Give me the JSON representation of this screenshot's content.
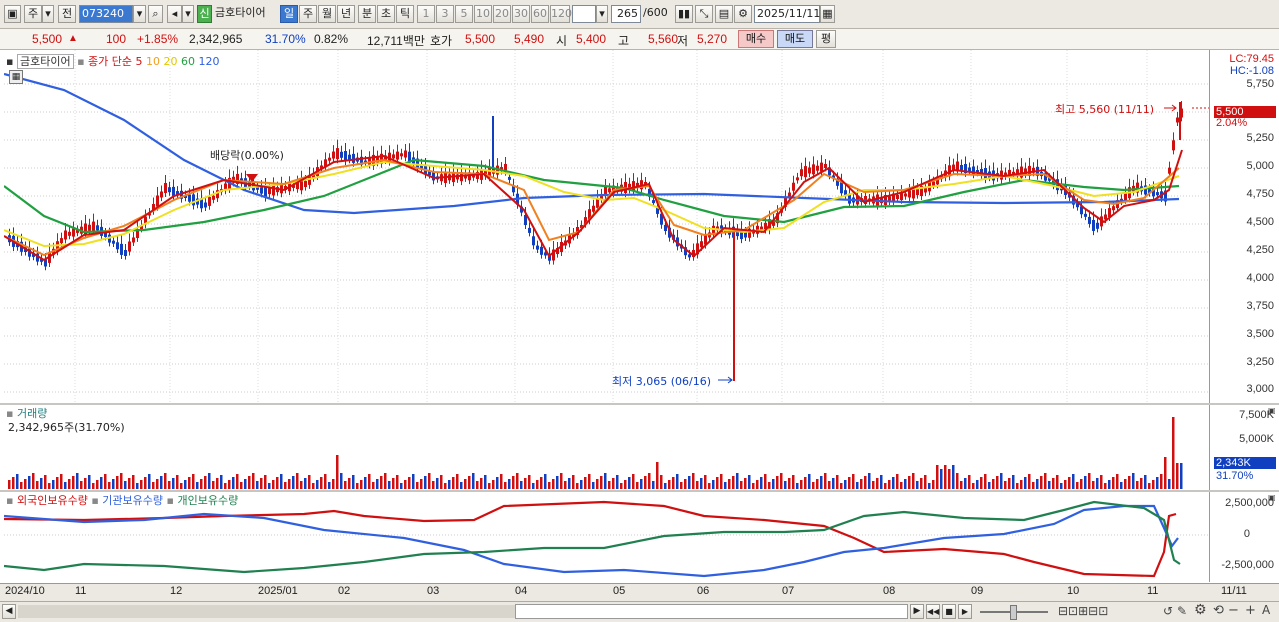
{
  "toolbar": {
    "period_main": "주",
    "prefix_label": "전",
    "stock_code": "073240",
    "credit_badge": "신",
    "stock_name": "금호타이어",
    "periods": [
      "일",
      "주",
      "월",
      "년",
      "분",
      "초",
      "틱"
    ],
    "intervals": [
      "1",
      "3",
      "5",
      "10",
      "20",
      "30",
      "60",
      "120"
    ],
    "candle_count": "265",
    "candle_total": "/600",
    "date": "2025/11/11"
  },
  "quote": {
    "price": "5,500",
    "change_arrow": "▲",
    "change": "100",
    "change_pct": "+1.85%",
    "volume": "2,342,965",
    "turnover": "31.70%",
    "ratio": "0.82%",
    "amount": "12,711백만",
    "bid_label": "호가",
    "bid1": "5,500",
    "bid2": "5,490",
    "open_label": "시",
    "open": "5,400",
    "high_label": "고",
    "high": "5,560",
    "low_label": "저",
    "low": "5,270",
    "buy_button": "매수",
    "sell_button": "매도",
    "eval_button": "평"
  },
  "price_panel": {
    "name": "금호타이어",
    "ma_title": "종가 단순",
    "ma_periods": [
      "5",
      "10",
      "20",
      "60",
      "120"
    ],
    "annotation_dividend": "배당락(0.00%)",
    "annotation_high": "최고 5,560 (11/11)",
    "annotation_low": "최저 3,065 (06/16)",
    "lc": "LC:79.45",
    "hc": "HC:-1.08",
    "current_tag": "5,500",
    "current_pct": "2.04%",
    "y_ticks": [
      "5,750",
      "5,500",
      "5,250",
      "5,000",
      "4,750",
      "4,500",
      "4,250",
      "4,000",
      "3,750",
      "3,500",
      "3,250",
      "3,000"
    ]
  },
  "volume_panel": {
    "title": "거래량",
    "value": "2,342,965주(31.70%)",
    "y_ticks": [
      "7,500K",
      "5,000K",
      "2,500K"
    ],
    "current_tag": "2,343K",
    "current_pct": "31.70%"
  },
  "holdings_panel": {
    "series": [
      "외국인보유수량",
      "기관보유수량",
      "개인보유수량"
    ],
    "y_ticks": [
      "2,500,000",
      "0",
      "-2,500,000"
    ]
  },
  "date_axis": [
    "2024/10",
    "11",
    "12",
    "2025/01",
    "02",
    "03",
    "04",
    "05",
    "06",
    "07",
    "08",
    "09",
    "10",
    "11",
    "11/11"
  ],
  "colors": {
    "up": "#d01010",
    "down": "#1040c0",
    "ma5": "#d01010",
    "ma10": "#f08020",
    "ma20": "#f0e020",
    "ma60": "#20a040",
    "ma120": "#3060e0",
    "foreign": "#d01010",
    "institution": "#3060e0",
    "individual": "#208050"
  }
}
